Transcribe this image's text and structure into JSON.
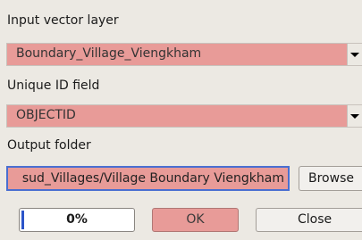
{
  "input_vector_layer": {
    "label": "Input vector layer",
    "value": "Boundary_Village_Viengkham"
  },
  "unique_id_field": {
    "label": "Unique ID field",
    "value": "OBJECTID"
  },
  "output_folder": {
    "label": "Output folder",
    "value": "sud_Villages/Village Boundary Viengkham"
  },
  "browse_button": {
    "label": "Browse"
  },
  "progress": {
    "text": "0%",
    "value": 0
  },
  "ok_button": {
    "label": "OK"
  },
  "close_button": {
    "label": "Close"
  },
  "colors": {
    "invalid_field": "#e89b98",
    "focus_border": "#4a6fd1",
    "progress_fill": "#2c54c9"
  }
}
